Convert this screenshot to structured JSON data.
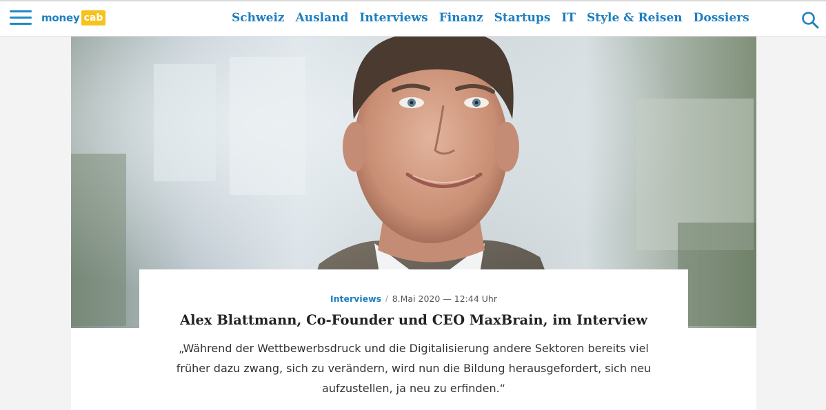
{
  "header": {
    "logo": {
      "money": "money",
      "cab": "cab"
    },
    "nav": [
      "Schweiz",
      "Ausland",
      "Interviews",
      "Finanz",
      "Startups",
      "IT",
      "Style & Reisen",
      "Dossiers"
    ],
    "icons": {
      "menu": "hamburger-menu-icon",
      "search": "search-icon"
    },
    "accent_color": "#1e7fbf",
    "logo_color": "#f6c21b"
  },
  "article": {
    "category": "Interviews",
    "separator": "/",
    "date": "8.Mai 2020 — 12:44 Uhr",
    "title": "Alex Blattmann, Co-Founder und CEO MaxBrain, im Interview",
    "lead": "„Während der Wettbewerbsdruck und die Digitalisierung andere Sektoren bereits viel früher dazu zwang, sich zu verändern, wird nun die Bildung herausgefordert, sich neu aufzustellen, ja neu zu erfinden.“"
  }
}
